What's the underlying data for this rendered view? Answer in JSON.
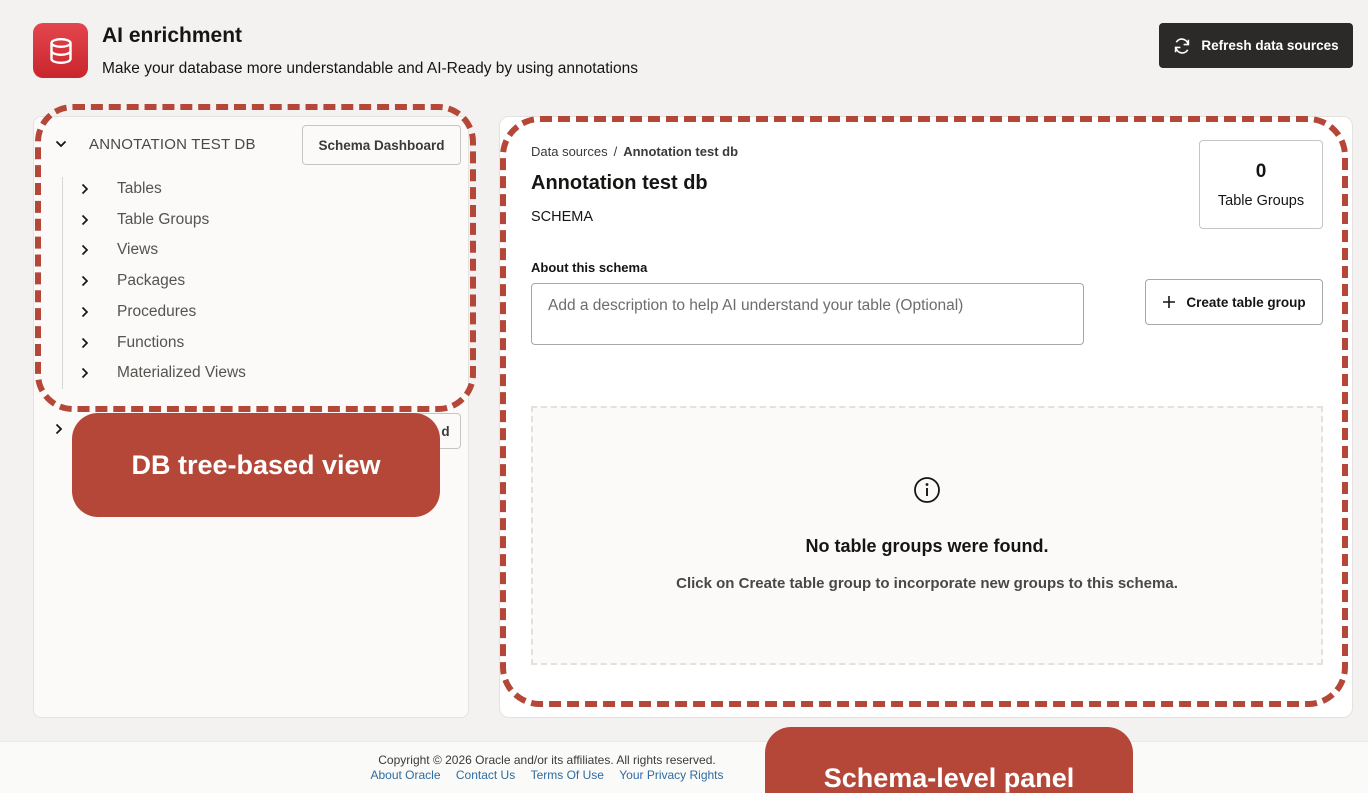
{
  "header": {
    "title": "AI enrichment",
    "subtitle": "Make your database more understandable and AI-Ready by using annotations",
    "refresh_label": "Refresh data sources"
  },
  "tree": {
    "db_name": "ANNOTATION TEST DB",
    "schema_dashboard_label": "Schema Dashboard",
    "items": [
      {
        "label": "Tables"
      },
      {
        "label": "Table Groups"
      },
      {
        "label": "Views"
      },
      {
        "label": "Packages"
      },
      {
        "label": "Procedures"
      },
      {
        "label": "Functions"
      },
      {
        "label": "Materialized Views"
      }
    ],
    "second_db_button_partial": "d"
  },
  "schema": {
    "breadcrumb_root": "Data sources",
    "breadcrumb_sep": "/",
    "breadcrumb_current": "Annotation test db",
    "title": "Annotation test db",
    "type": "SCHEMA",
    "stat_count": "0",
    "stat_label": "Table Groups",
    "about_label": "About this schema",
    "about_placeholder": "Add a description to help AI understand your table (Optional)",
    "create_group_label": "Create table group",
    "empty_title": "No table groups were found.",
    "empty_desc": "Click on Create table group to incorporate new groups to this schema."
  },
  "footer": {
    "copyright": "Copyright © 2026 Oracle and/or its affiliates. All rights reserved.",
    "links": [
      "About Oracle",
      "Contact Us",
      "Terms Of Use",
      "Your Privacy Rights"
    ]
  },
  "annotations": {
    "callout_tree": "DB tree-based view",
    "callout_schema": "Schema-level panel",
    "color": "#b44738"
  },
  "colors": {
    "brand_red": "#d1343c",
    "dark_button": "#2b2a28"
  }
}
